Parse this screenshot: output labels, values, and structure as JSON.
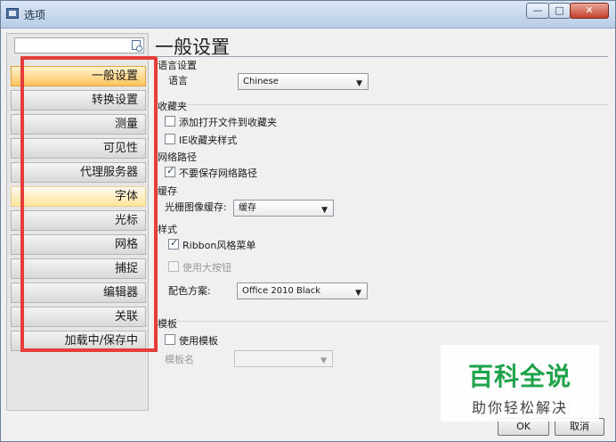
{
  "window": {
    "title": "选项",
    "close_symbol": "✕",
    "min_symbol": "—",
    "max_symbol": "□"
  },
  "sidebar": {
    "search": {
      "value": "",
      "placeholder": ""
    },
    "items": [
      {
        "label": "一般设置",
        "state": "active"
      },
      {
        "label": "转换设置"
      },
      {
        "label": "测量"
      },
      {
        "label": "可见性"
      },
      {
        "label": "代理服务器"
      },
      {
        "label": "字体",
        "state": "hover"
      },
      {
        "label": "光标"
      },
      {
        "label": "网格"
      },
      {
        "label": "捕捉"
      },
      {
        "label": "编辑器"
      },
      {
        "label": "关联"
      },
      {
        "label": "加载中/保存中"
      }
    ]
  },
  "main": {
    "title": "一般设置",
    "language": {
      "section": "语言设置",
      "label": "语言",
      "value": "Chinese"
    },
    "favorites": {
      "section": "收藏夹",
      "add_open_files": "添加打开文件到收藏夹",
      "ie_style": "IE收藏夹样式",
      "add_open_files_checked": false,
      "ie_style_checked": false
    },
    "network_path": {
      "section": "网络路径",
      "dont_save": "不要保存网络路径",
      "dont_save_checked": true
    },
    "cache": {
      "section": "缓存",
      "label": "光栅图像缓存:",
      "value": "缓存"
    },
    "style": {
      "section": "样式",
      "ribbon": "Ribbon风格菜单",
      "ribbon_checked": true,
      "large_buttons": "使用大按钮",
      "large_buttons_checked": false,
      "large_buttons_enabled": false,
      "color_scheme_label": "配色方案:",
      "color_scheme_value": "Office 2010 Black"
    },
    "template": {
      "section": "模板",
      "use_template": "使用模板",
      "use_template_checked": false,
      "name_label": "模板名",
      "name_value": "",
      "name_enabled": false
    }
  },
  "footer": {
    "ok": "OK",
    "cancel": "取消"
  },
  "watermark": {
    "main": "百科全说",
    "sub": "助你轻松解决"
  },
  "colors": {
    "highlight_box": "#e63c3c",
    "active_nav": "#ffc35c",
    "watermark_green": "#1fa34a"
  }
}
